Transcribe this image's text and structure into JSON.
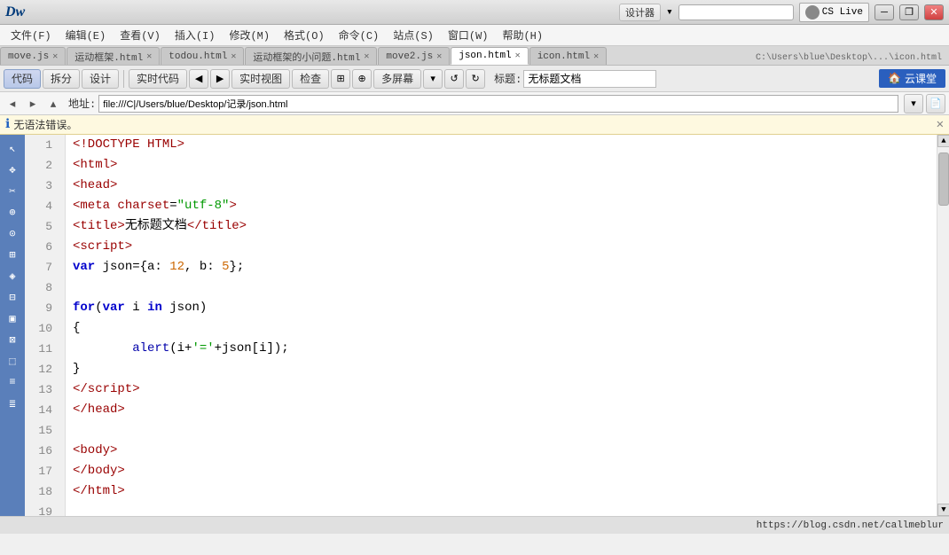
{
  "titleBar": {
    "appLogo": "Dw",
    "title": "",
    "searchPlaceholder": "",
    "designer": "设计器",
    "csLive": "CS Live",
    "btnMin": "─",
    "btnMax": "❐",
    "btnClose": "✕"
  },
  "menuBar": {
    "items": [
      "文件(F)",
      "编辑(E)",
      "查看(V)",
      "插入(I)",
      "修改(M)",
      "格式(O)",
      "命令(C)",
      "站点(S)",
      "窗口(W)",
      "帮助(H)"
    ]
  },
  "tabs": [
    {
      "label": "move.js",
      "active": false
    },
    {
      "label": "运动框架.html",
      "active": false
    },
    {
      "label": "todou.html",
      "active": false
    },
    {
      "label": "运动框架的小问题.html",
      "active": false
    },
    {
      "label": "move2.js",
      "active": false
    },
    {
      "label": "json.html",
      "active": true
    },
    {
      "label": "icon.html",
      "active": false
    }
  ],
  "tabPath": "C:\\Users\\blue\\Desktop\\...\\icon.html",
  "toolbar": {
    "codeBtn": "代码",
    "splitBtn": "拆分",
    "designBtn": "设计",
    "realtimeCodeBtn": "实时代码",
    "realtimeViewBtn": "实时视图",
    "checkBtn": "检查",
    "multiScreenBtn": "多屏幕",
    "titleLabel": "标题:",
    "titleValue": "无标题文档",
    "cloudLogo": "🏠 云课堂"
  },
  "navBar": {
    "addressLabel": "地址:",
    "addressValue": "file:///C|/Users/blue/Desktop/记录/json.html"
  },
  "infoBar": {
    "text": "无语法错误。",
    "closeBtn": "✕"
  },
  "code": {
    "lines": [
      {
        "num": 1,
        "html": "<span class='tag'>&lt;!DOCTYPE HTML&gt;</span>"
      },
      {
        "num": 2,
        "html": "<span class='tag'>&lt;html&gt;</span>"
      },
      {
        "num": 3,
        "html": "<span class='tag'>&lt;head&gt;</span>"
      },
      {
        "num": 4,
        "html": "<span class='tag'>&lt;meta</span> <span class='attr-name'>charset</span><span class='plain'>=</span><span class='attr-val'>\"utf-8\"</span><span class='tag'>&gt;</span>"
      },
      {
        "num": 5,
        "html": "<span class='tag'>&lt;title&gt;</span><span class='plain'>无标题文档</span><span class='tag'>&lt;/title&gt;</span>"
      },
      {
        "num": 6,
        "html": "<span class='tag'>&lt;script&gt;</span>"
      },
      {
        "num": 7,
        "html": "<span class='kw-var'>var</span> <span class='plain'>json={a: </span><span class='number'>12</span><span class='plain'>, b: </span><span class='number'>5</span><span class='plain'>};</span>"
      },
      {
        "num": 8,
        "html": ""
      },
      {
        "num": 9,
        "html": "<span class='kw-for'>for</span><span class='plain'>(</span><span class='kw-var'>var</span><span class='plain'> i </span><span class='kw-for'>in</span><span class='plain'> json)</span>"
      },
      {
        "num": 10,
        "html": "<span class='plain'>{</span>"
      },
      {
        "num": 11,
        "html": "<span class='plain'>        </span><span class='func'>alert</span><span class='plain'>(i+</span><span class='string'>'='</span><span class='plain'>+json[i]);</span>"
      },
      {
        "num": 12,
        "html": "<span class='plain'>}</span>"
      },
      {
        "num": 13,
        "html": "<span class='tag'>&lt;/script&gt;</span>"
      },
      {
        "num": 14,
        "html": "<span class='tag'>&lt;/head&gt;</span>"
      },
      {
        "num": 15,
        "html": ""
      },
      {
        "num": 16,
        "html": "<span class='tag'>&lt;body&gt;</span>"
      },
      {
        "num": 17,
        "html": "<span class='tag'>&lt;/body&gt;</span>"
      },
      {
        "num": 18,
        "html": "<span class='tag'>&lt;/html&gt;</span>"
      },
      {
        "num": 19,
        "html": ""
      }
    ]
  },
  "statusBar": {
    "url": "https://blog.csdn.net/callmeblur"
  },
  "sidebarIcons": [
    "↖",
    "✥",
    "✂",
    "⊕",
    "⊙",
    "⊞",
    "◈",
    "⊟",
    "▣",
    "⊠",
    "⬚",
    "≡",
    "≣"
  ]
}
